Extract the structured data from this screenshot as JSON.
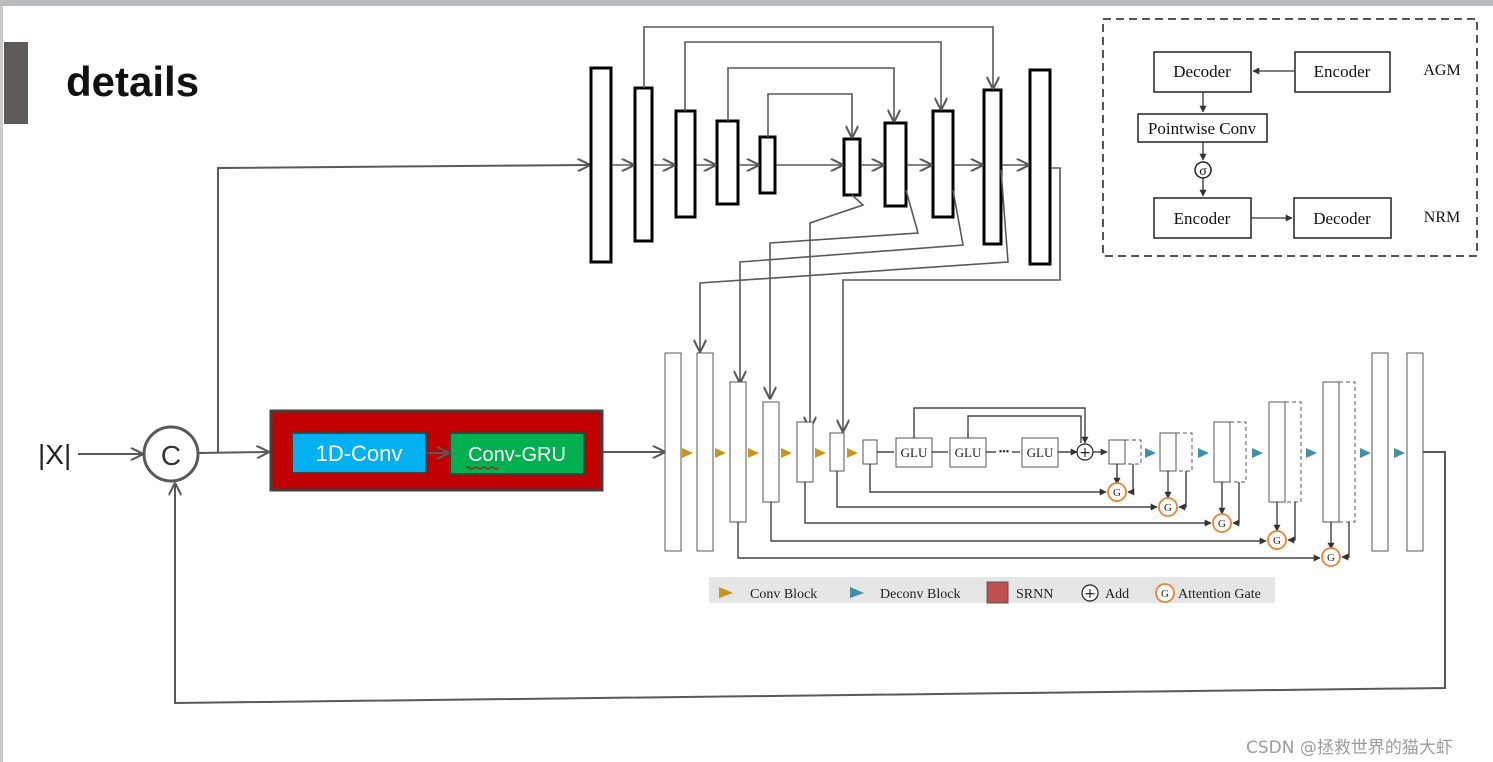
{
  "slide": {
    "title": "details"
  },
  "main_flow": {
    "input_label": "|X|",
    "concat_label": "C",
    "srnn_blocks": {
      "conv1d": "1D-Conv",
      "conv_gru": "Conv-GRU"
    }
  },
  "unet": {
    "glu_blocks": [
      "GLU",
      "GLU",
      "GLU"
    ],
    "ellipsis": "•••",
    "add_symbol": "+",
    "gate_symbol": "G"
  },
  "legend": {
    "items": [
      {
        "label": "Conv Block",
        "color": "#c8961e"
      },
      {
        "label": "Deconv Block",
        "color": "#3e8fa8"
      },
      {
        "label": "SRNN",
        "color": "#c0504d"
      },
      {
        "label": "Add"
      },
      {
        "label": "Attention Gate",
        "color": "#e8823a"
      }
    ]
  },
  "inset": {
    "top_row": {
      "left": "Decoder",
      "right": "Encoder",
      "tag": "AGM"
    },
    "middle": "Pointwise Conv",
    "sigma": "σ",
    "bottom_row": {
      "left": "Encoder",
      "right": "Decoder",
      "tag": "NRM"
    }
  },
  "watermark": "CSDN @拯救世界的猫大虾",
  "colors": {
    "srnn_frame": "#c00000",
    "conv1d_fill": "#00b0f0",
    "convgru_fill": "#00b050",
    "arrow_gray": "#595959"
  }
}
